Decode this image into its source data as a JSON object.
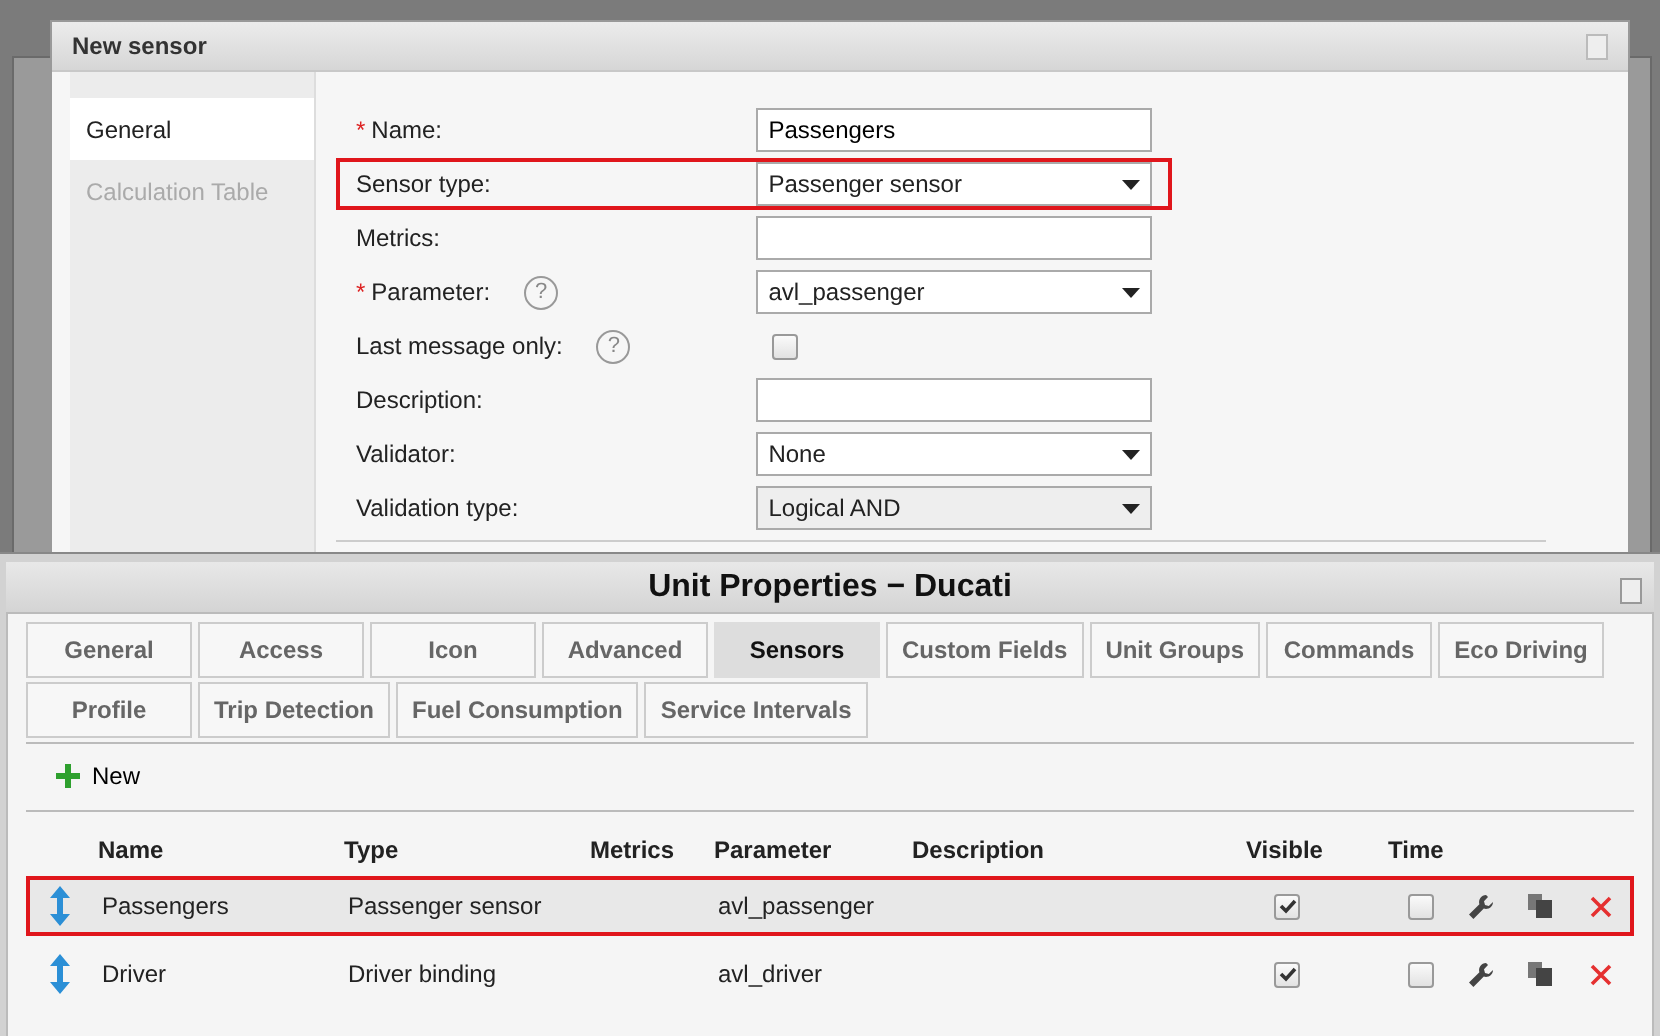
{
  "dialog": {
    "title": "New sensor",
    "nav": [
      {
        "label": "General",
        "selected": true
      },
      {
        "label": "Calculation Table",
        "selected": false
      }
    ],
    "fields": [
      {
        "kind": "text",
        "label": "Name:",
        "required_mark": "*",
        "value": "Passengers",
        "highlighted": false
      },
      {
        "kind": "select",
        "label": "Sensor type:",
        "value": "Passenger sensor",
        "disabled": false,
        "highlighted": true
      },
      {
        "kind": "text",
        "label": "Metrics:",
        "highlighted": false
      },
      {
        "kind": "select",
        "label": "Parameter:",
        "required_mark": "*",
        "help": "?",
        "value": "avl_passenger",
        "disabled": false,
        "highlighted": false
      },
      {
        "kind": "checkbox",
        "label": "Last message only:",
        "help": "?",
        "checked": false,
        "highlighted": false
      },
      {
        "kind": "text",
        "label": "Description:",
        "highlighted": false
      },
      {
        "kind": "select",
        "label": "Validator:",
        "value": "None",
        "disabled": false,
        "highlighted": false
      },
      {
        "kind": "select",
        "label": "Validation type:",
        "value": "Logical AND",
        "disabled": true,
        "highlighted": false
      }
    ]
  },
  "window": {
    "title": "Unit Properties − Ducati",
    "tab_rows": [
      [
        {
          "label": "General",
          "selected": false
        },
        {
          "label": "Access",
          "selected": false
        },
        {
          "label": "Icon",
          "selected": false
        },
        {
          "label": "Advanced",
          "selected": false
        },
        {
          "label": "Sensors",
          "selected": true
        },
        {
          "label": "Custom Fields",
          "selected": false
        },
        {
          "label": "Unit Groups",
          "selected": false
        },
        {
          "label": "Commands",
          "selected": false
        },
        {
          "label": "Eco Driving",
          "selected": false
        }
      ],
      [
        {
          "label": "Profile",
          "selected": false
        },
        {
          "label": "Trip Detection",
          "selected": false
        },
        {
          "label": "Fuel Consumption",
          "selected": false
        },
        {
          "label": "Service Intervals",
          "selected": false
        }
      ]
    ],
    "new_button": "New",
    "table": {
      "columns": [
        "Name",
        "Type",
        "Metrics",
        "Parameter",
        "Description",
        "Visible",
        "Time"
      ],
      "rows": [
        {
          "name": "Passengers",
          "type": "Passenger sensor",
          "parameter": "avl_passenger",
          "visible": true,
          "time": false,
          "selected": true,
          "highlighted": true
        },
        {
          "name": "Driver",
          "type": "Driver binding",
          "parameter": "avl_driver",
          "visible": true,
          "time": false,
          "selected": false,
          "highlighted": false
        }
      ]
    }
  }
}
